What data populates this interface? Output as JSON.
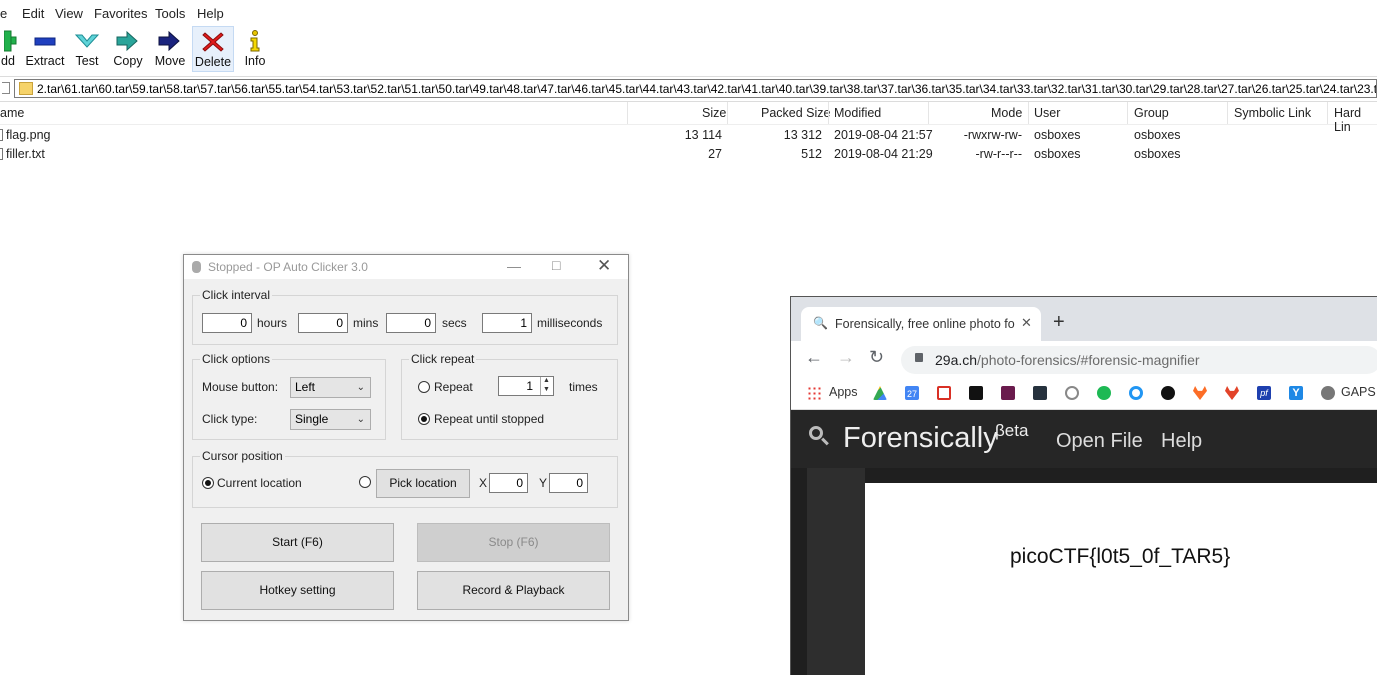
{
  "menubar": {
    "file": "e",
    "edit": "Edit",
    "view": "View",
    "favorites": "Favorites",
    "tools": "Tools",
    "help": "Help"
  },
  "toolbar": {
    "add": "dd",
    "extract": "Extract",
    "test": "Test",
    "copy": "Copy",
    "move": "Move",
    "delete": "Delete",
    "info": "Info"
  },
  "address": {
    "path": "2.tar\\61.tar\\60.tar\\59.tar\\58.tar\\57.tar\\56.tar\\55.tar\\54.tar\\53.tar\\52.tar\\51.tar\\50.tar\\49.tar\\48.tar\\47.tar\\46.tar\\45.tar\\44.tar\\43.tar\\42.tar\\41.tar\\40.tar\\39.tar\\38.tar\\37.tar\\36.tar\\35.tar\\34.tar\\33.tar\\32.tar\\31.tar\\30.tar\\29.tar\\28.tar\\27.tar\\26.tar\\25.tar\\24.tar\\23.t"
  },
  "columns": {
    "name": "ame",
    "size": "Size",
    "packed": "Packed Size",
    "modified": "Modified",
    "mode": "Mode",
    "user": "User",
    "group": "Group",
    "symlink": "Symbolic Link",
    "hardlink": "Hard Lin"
  },
  "files": [
    {
      "name": "flag.png",
      "size": "13 114",
      "packed": "13 312",
      "modified": "2019-08-04 21:57",
      "mode": "-rwxrw-rw-",
      "user": "osboxes",
      "group": "osboxes"
    },
    {
      "name": "filler.txt",
      "size": "27",
      "packed": "512",
      "modified": "2019-08-04 21:29",
      "mode": "-rw-r--r--",
      "user": "osboxes",
      "group": "osboxes"
    }
  ],
  "autoclicker": {
    "title": "Stopped - OP Auto Clicker 3.0",
    "click_interval": "Click interval",
    "hours_val": "0",
    "hours": "hours",
    "mins_val": "0",
    "mins": "mins",
    "secs_val": "0",
    "secs": "secs",
    "ms_val": "1",
    "ms": "milliseconds",
    "click_options": "Click options",
    "mouse_button_label": "Mouse button:",
    "mouse_button": "Left",
    "click_type_label": "Click type:",
    "click_type": "Single",
    "click_repeat": "Click repeat",
    "repeat": "Repeat",
    "repeat_val": "1",
    "times": "times",
    "repeat_until": "Repeat until stopped",
    "cursor_position": "Cursor position",
    "current_location": "Current location",
    "pick_location": "Pick location",
    "x_label": "X",
    "x_val": "0",
    "y_label": "Y",
    "y_val": "0",
    "start": "Start (F6)",
    "stop": "Stop (F6)",
    "hotkey": "Hotkey setting",
    "record": "Record & Playback"
  },
  "browser": {
    "tab_title": "Forensically, free online photo fo",
    "url_host": "29a.ch",
    "url_path": "/photo-forensics/#forensic-magnifier",
    "apps": "Apps",
    "gaps": "GAPS",
    "bookmark_27": "27",
    "site_brand": "Forensically",
    "site_beta": "βeta",
    "open_file": "Open File",
    "help": "Help",
    "flag_text": "picoCTF{l0t5_0f_TAR5}"
  },
  "colors": {
    "accent_blue": "#1a73e8",
    "delete_red": "#e11b1b",
    "site_dark": "#1f1f1f"
  }
}
